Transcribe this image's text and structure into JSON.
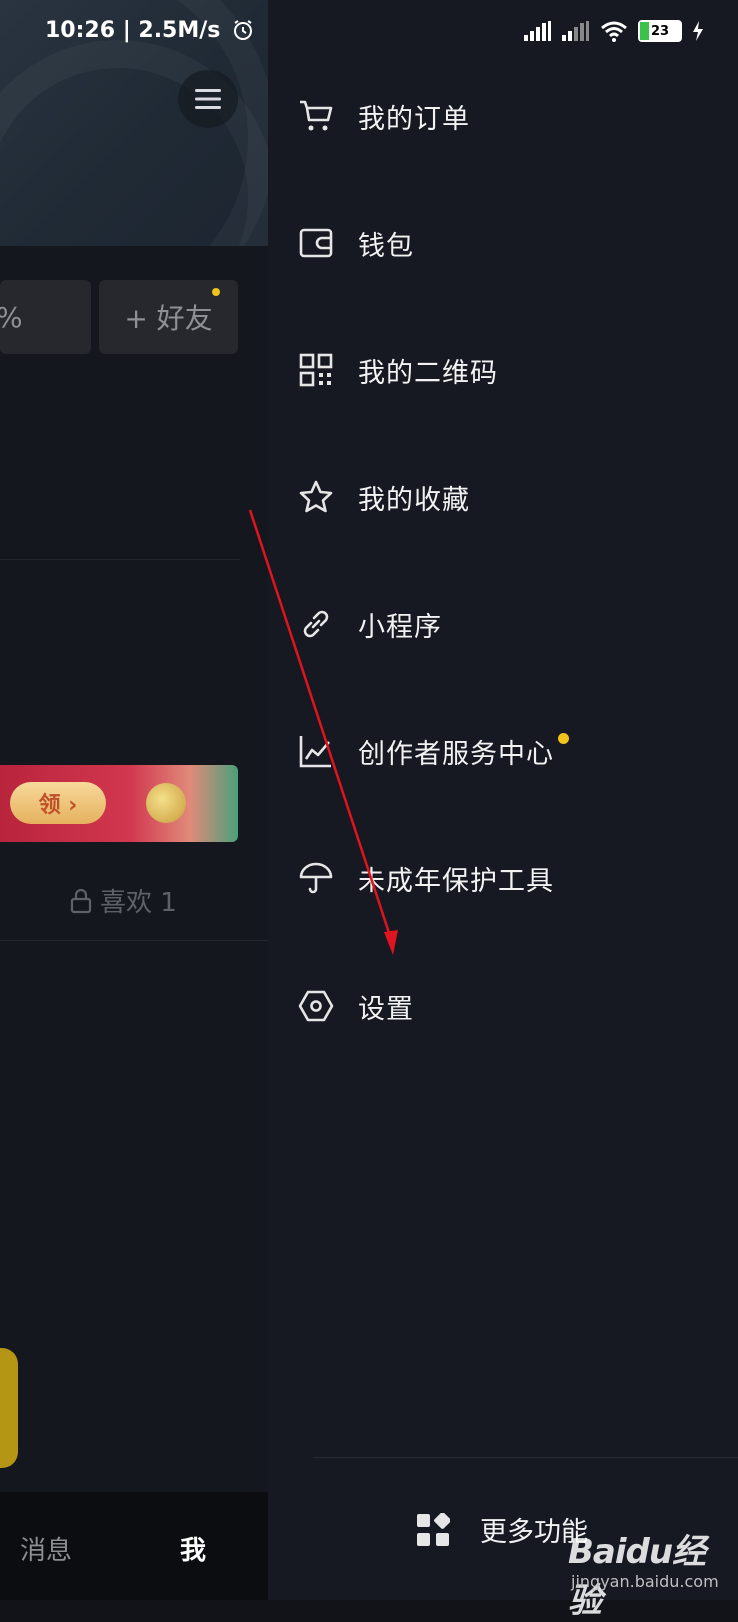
{
  "status_bar": {
    "time_speed": "10:26 | 2.5M/s",
    "battery": "23"
  },
  "left_page": {
    "chip_left_text": "%",
    "add_friend": "+ 好友",
    "claim_button": "领 ›",
    "likes": "喜欢 1",
    "nav_messages": "消息",
    "nav_me": "我"
  },
  "drawer": {
    "items": [
      {
        "label": "我的订单",
        "icon": "cart-icon"
      },
      {
        "label": "钱包",
        "icon": "wallet-icon"
      },
      {
        "label": "我的二维码",
        "icon": "qr-code-icon"
      },
      {
        "label": "我的收藏",
        "icon": "star-icon"
      },
      {
        "label": "小程序",
        "icon": "link-icon"
      },
      {
        "label": "创作者服务中心",
        "icon": "chart-icon",
        "badge": true
      },
      {
        "label": "未成年保护工具",
        "icon": "umbrella-icon"
      },
      {
        "label": "设置",
        "icon": "settings-hexagon-icon"
      }
    ],
    "more_label": "更多功能"
  },
  "watermark": {
    "main": "Baidu经验",
    "sub": "jingyan.baidu.com"
  },
  "colors": {
    "drawer_bg": "#161822",
    "badge": "#f1c21b",
    "annotation_arrow": "#e0141e"
  }
}
